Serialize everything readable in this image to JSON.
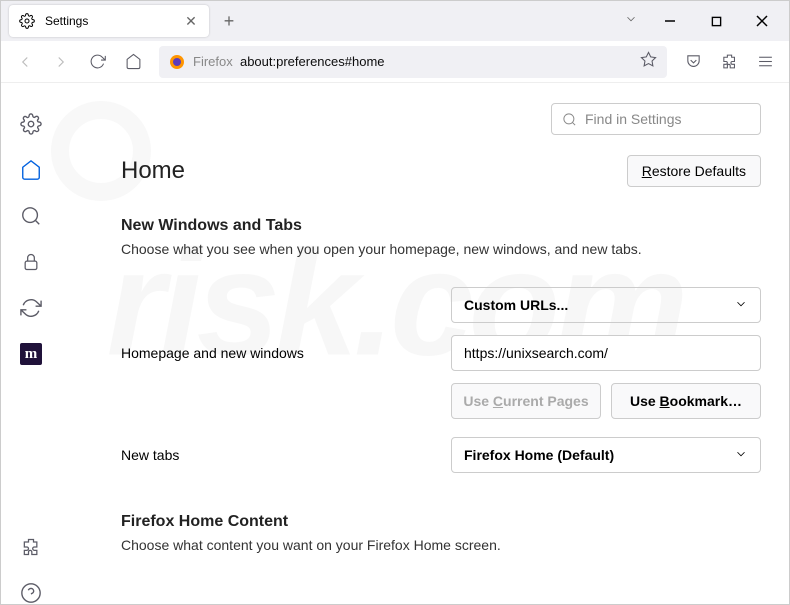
{
  "tab": {
    "title": "Settings"
  },
  "url": {
    "brand": "Firefox",
    "path": "about:preferences#home"
  },
  "search": {
    "placeholder": "Find in Settings"
  },
  "heading": "Home",
  "restore": "Restore Defaults",
  "section1": {
    "title": "New Windows and Tabs",
    "desc": "Choose what you see when you open your homepage, new windows, and new tabs."
  },
  "homepage": {
    "dropdown": "Custom URLs...",
    "label": "Homepage and new windows",
    "value": "https://unixsearch.com/",
    "use_current": "Use Current Pages",
    "use_bookmark": "Use Bookmark…"
  },
  "newtabs": {
    "label": "New tabs",
    "dropdown": "Firefox Home (Default)"
  },
  "section2": {
    "title": "Firefox Home Content",
    "desc": "Choose what content you want on your Firefox Home screen."
  }
}
